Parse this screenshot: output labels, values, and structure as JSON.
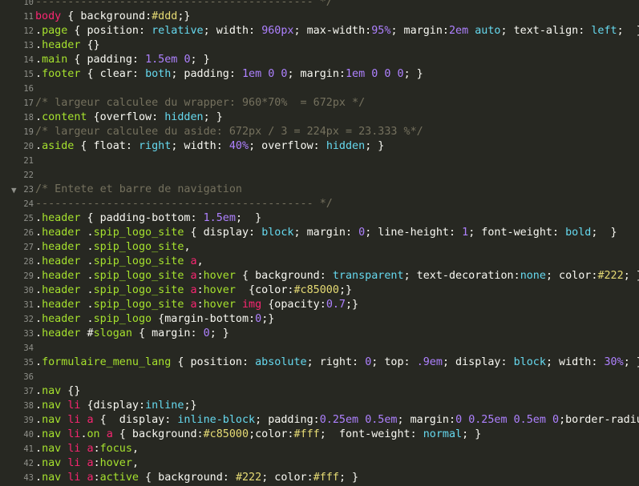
{
  "theme": {
    "background": "#272822",
    "foreground": "#f8f8f2",
    "comment": "#75715e",
    "keyword": "#f92672",
    "selector": "#a6e22e",
    "property": "#66d9ef",
    "number": "#ae81ff",
    "string": "#e6db74",
    "gutter": "#8f908a"
  },
  "editor": {
    "fold_icon": "triangle-down",
    "lines": [
      {
        "num": "10",
        "fold": false,
        "tokens": [
          [
            "comment",
            "------------------------------------------- */"
          ]
        ]
      },
      {
        "num": "11",
        "fold": false,
        "tokens": [
          [
            "tag",
            "body"
          ],
          [
            "plain",
            " { background"
          ],
          [
            "plain",
            ":"
          ],
          [
            "color",
            "#ddd"
          ],
          [
            "plain",
            ";}"
          ]
        ]
      },
      {
        "num": "12",
        "fold": false,
        "tokens": [
          [
            "plain",
            "."
          ],
          [
            "class",
            "page"
          ],
          [
            "plain",
            " { position: "
          ],
          [
            "prop",
            "relative"
          ],
          [
            "plain",
            "; width: "
          ],
          [
            "num",
            "960px"
          ],
          [
            "plain",
            "; max-width:"
          ],
          [
            "num",
            "95%"
          ],
          [
            "plain",
            "; margin:"
          ],
          [
            "num",
            "2em"
          ],
          [
            "plain",
            " "
          ],
          [
            "prop",
            "auto"
          ],
          [
            "plain",
            "; text-align: "
          ],
          [
            "prop",
            "left"
          ],
          [
            "plain",
            ";  }"
          ]
        ]
      },
      {
        "num": "13",
        "fold": false,
        "tokens": [
          [
            "plain",
            "."
          ],
          [
            "class",
            "header"
          ],
          [
            "plain",
            " {}"
          ]
        ]
      },
      {
        "num": "14",
        "fold": false,
        "tokens": [
          [
            "plain",
            "."
          ],
          [
            "class",
            "main"
          ],
          [
            "plain",
            " { padding: "
          ],
          [
            "num",
            "1.5em"
          ],
          [
            "plain",
            " "
          ],
          [
            "num",
            "0"
          ],
          [
            "plain",
            "; }"
          ]
        ]
      },
      {
        "num": "15",
        "fold": false,
        "tokens": [
          [
            "plain",
            "."
          ],
          [
            "class",
            "footer"
          ],
          [
            "plain",
            " { clear: "
          ],
          [
            "prop",
            "both"
          ],
          [
            "plain",
            "; padding: "
          ],
          [
            "num",
            "1em"
          ],
          [
            "plain",
            " "
          ],
          [
            "num",
            "0"
          ],
          [
            "plain",
            " "
          ],
          [
            "num",
            "0"
          ],
          [
            "plain",
            "; margin:"
          ],
          [
            "num",
            "1em"
          ],
          [
            "plain",
            " "
          ],
          [
            "num",
            "0"
          ],
          [
            "plain",
            " "
          ],
          [
            "num",
            "0"
          ],
          [
            "plain",
            " "
          ],
          [
            "num",
            "0"
          ],
          [
            "plain",
            "; }"
          ]
        ]
      },
      {
        "num": "16",
        "fold": false,
        "tokens": []
      },
      {
        "num": "17",
        "fold": false,
        "tokens": [
          [
            "comment",
            "/* largeur calculee du wrapper: 960*70%  = 672px */"
          ]
        ]
      },
      {
        "num": "18",
        "fold": false,
        "tokens": [
          [
            "plain",
            "."
          ],
          [
            "class",
            "content"
          ],
          [
            "plain",
            " {overflow: "
          ],
          [
            "prop",
            "hidden"
          ],
          [
            "plain",
            "; }"
          ]
        ]
      },
      {
        "num": "19",
        "fold": false,
        "tokens": [
          [
            "comment",
            "/* largeur calculee du aside: 672px / 3 = 224px = 23.333 %*/"
          ]
        ]
      },
      {
        "num": "20",
        "fold": false,
        "tokens": [
          [
            "plain",
            "."
          ],
          [
            "class",
            "aside"
          ],
          [
            "plain",
            " { float: "
          ],
          [
            "prop",
            "right"
          ],
          [
            "plain",
            "; width: "
          ],
          [
            "num",
            "40%"
          ],
          [
            "plain",
            "; overflow: "
          ],
          [
            "prop",
            "hidden"
          ],
          [
            "plain",
            "; }"
          ]
        ]
      },
      {
        "num": "21",
        "fold": false,
        "tokens": []
      },
      {
        "num": "22",
        "fold": false,
        "tokens": []
      },
      {
        "num": "23",
        "fold": true,
        "tokens": [
          [
            "comment",
            "/* Entete et barre de navigation"
          ]
        ]
      },
      {
        "num": "24",
        "fold": false,
        "tokens": [
          [
            "comment",
            "------------------------------------------- */"
          ]
        ]
      },
      {
        "num": "25",
        "fold": false,
        "tokens": [
          [
            "plain",
            "."
          ],
          [
            "class",
            "header"
          ],
          [
            "plain",
            " { padding-bottom: "
          ],
          [
            "num",
            "1.5em"
          ],
          [
            "plain",
            ";  }"
          ]
        ]
      },
      {
        "num": "26",
        "fold": false,
        "tokens": [
          [
            "plain",
            "."
          ],
          [
            "class",
            "header"
          ],
          [
            "plain",
            " ."
          ],
          [
            "class",
            "spip_logo_site"
          ],
          [
            "plain",
            " { display: "
          ],
          [
            "prop",
            "block"
          ],
          [
            "plain",
            "; margin: "
          ],
          [
            "num",
            "0"
          ],
          [
            "plain",
            "; line-height: "
          ],
          [
            "num",
            "1"
          ],
          [
            "plain",
            "; font-weight: "
          ],
          [
            "prop",
            "bold"
          ],
          [
            "plain",
            ";  }"
          ]
        ]
      },
      {
        "num": "27",
        "fold": false,
        "tokens": [
          [
            "plain",
            "."
          ],
          [
            "class",
            "header"
          ],
          [
            "plain",
            " ."
          ],
          [
            "class",
            "spip_logo_site"
          ],
          [
            "plain",
            ","
          ]
        ]
      },
      {
        "num": "28",
        "fold": false,
        "tokens": [
          [
            "plain",
            "."
          ],
          [
            "class",
            "header"
          ],
          [
            "plain",
            " ."
          ],
          [
            "class",
            "spip_logo_site"
          ],
          [
            "plain",
            " "
          ],
          [
            "tag",
            "a"
          ],
          [
            "plain",
            ","
          ]
        ]
      },
      {
        "num": "29",
        "fold": false,
        "tokens": [
          [
            "plain",
            "."
          ],
          [
            "class",
            "header"
          ],
          [
            "plain",
            " ."
          ],
          [
            "class",
            "spip_logo_site"
          ],
          [
            "plain",
            " "
          ],
          [
            "tag",
            "a"
          ],
          [
            "plain",
            ":"
          ],
          [
            "class",
            "hover"
          ],
          [
            "plain",
            " { background: "
          ],
          [
            "prop",
            "transparent"
          ],
          [
            "plain",
            "; text-decoration:"
          ],
          [
            "prop",
            "none"
          ],
          [
            "plain",
            "; color:"
          ],
          [
            "color",
            "#222"
          ],
          [
            "plain",
            "; }"
          ]
        ]
      },
      {
        "num": "30",
        "fold": false,
        "tokens": [
          [
            "plain",
            "."
          ],
          [
            "class",
            "header"
          ],
          [
            "plain",
            " ."
          ],
          [
            "class",
            "spip_logo_site"
          ],
          [
            "plain",
            " "
          ],
          [
            "tag",
            "a"
          ],
          [
            "plain",
            ":"
          ],
          [
            "class",
            "hover"
          ],
          [
            "plain",
            "  {color:"
          ],
          [
            "color",
            "#c85000"
          ],
          [
            "plain",
            ";}"
          ]
        ]
      },
      {
        "num": "31",
        "fold": false,
        "tokens": [
          [
            "plain",
            "."
          ],
          [
            "class",
            "header"
          ],
          [
            "plain",
            " ."
          ],
          [
            "class",
            "spip_logo_site"
          ],
          [
            "plain",
            " "
          ],
          [
            "tag",
            "a"
          ],
          [
            "plain",
            ":"
          ],
          [
            "class",
            "hover"
          ],
          [
            "plain",
            " "
          ],
          [
            "tag",
            "img"
          ],
          [
            "plain",
            " {opacity:"
          ],
          [
            "num",
            "0.7"
          ],
          [
            "plain",
            ";}"
          ]
        ]
      },
      {
        "num": "32",
        "fold": false,
        "tokens": [
          [
            "plain",
            "."
          ],
          [
            "class",
            "header"
          ],
          [
            "plain",
            " ."
          ],
          [
            "class",
            "spip_logo"
          ],
          [
            "plain",
            " {margin-bottom:"
          ],
          [
            "num",
            "0"
          ],
          [
            "plain",
            ";}"
          ]
        ]
      },
      {
        "num": "33",
        "fold": false,
        "tokens": [
          [
            "plain",
            "."
          ],
          [
            "class",
            "header"
          ],
          [
            "plain",
            " #"
          ],
          [
            "class",
            "slogan"
          ],
          [
            "plain",
            " { margin: "
          ],
          [
            "num",
            "0"
          ],
          [
            "plain",
            "; }"
          ]
        ]
      },
      {
        "num": "34",
        "fold": false,
        "tokens": []
      },
      {
        "num": "35",
        "fold": false,
        "tokens": [
          [
            "plain",
            "."
          ],
          [
            "class",
            "formulaire_menu_lang"
          ],
          [
            "plain",
            " { position: "
          ],
          [
            "prop",
            "absolute"
          ],
          [
            "plain",
            "; right: "
          ],
          [
            "num",
            "0"
          ],
          [
            "plain",
            "; top: "
          ],
          [
            "num",
            ".9em"
          ],
          [
            "plain",
            "; display: "
          ],
          [
            "prop",
            "block"
          ],
          [
            "plain",
            "; width: "
          ],
          [
            "num",
            "30%"
          ],
          [
            "plain",
            "; }"
          ]
        ]
      },
      {
        "num": "36",
        "fold": false,
        "tokens": []
      },
      {
        "num": "37",
        "fold": false,
        "tokens": [
          [
            "plain",
            "."
          ],
          [
            "class",
            "nav"
          ],
          [
            "plain",
            " {}"
          ]
        ]
      },
      {
        "num": "38",
        "fold": false,
        "tokens": [
          [
            "plain",
            "."
          ],
          [
            "class",
            "nav"
          ],
          [
            "plain",
            " "
          ],
          [
            "tag",
            "li"
          ],
          [
            "plain",
            " {display:"
          ],
          [
            "prop",
            "inline"
          ],
          [
            "plain",
            ";}"
          ]
        ]
      },
      {
        "num": "39",
        "fold": false,
        "tokens": [
          [
            "plain",
            "."
          ],
          [
            "class",
            "nav"
          ],
          [
            "plain",
            " "
          ],
          [
            "tag",
            "li"
          ],
          [
            "plain",
            " "
          ],
          [
            "tag",
            "a"
          ],
          [
            "plain",
            " {  display: "
          ],
          [
            "prop",
            "inline-block"
          ],
          [
            "plain",
            "; padding:"
          ],
          [
            "num",
            "0.25em"
          ],
          [
            "plain",
            " "
          ],
          [
            "num",
            "0.5em"
          ],
          [
            "plain",
            "; margin:"
          ],
          [
            "num",
            "0"
          ],
          [
            "plain",
            " "
          ],
          [
            "num",
            "0.25em"
          ],
          [
            "plain",
            " "
          ],
          [
            "num",
            "0.5em"
          ],
          [
            "plain",
            " "
          ],
          [
            "num",
            "0"
          ],
          [
            "plain",
            ";border-radius:"
          ]
        ]
      },
      {
        "num": "40",
        "fold": false,
        "tokens": [
          [
            "plain",
            "."
          ],
          [
            "class",
            "nav"
          ],
          [
            "plain",
            " "
          ],
          [
            "tag",
            "li"
          ],
          [
            "plain",
            "."
          ],
          [
            "class",
            "on"
          ],
          [
            "plain",
            " "
          ],
          [
            "tag",
            "a"
          ],
          [
            "plain",
            " { background:"
          ],
          [
            "color",
            "#c85000"
          ],
          [
            "plain",
            ";color:"
          ],
          [
            "color",
            "#fff"
          ],
          [
            "plain",
            ";  font-weight: "
          ],
          [
            "prop",
            "normal"
          ],
          [
            "plain",
            "; }"
          ]
        ]
      },
      {
        "num": "41",
        "fold": false,
        "tokens": [
          [
            "plain",
            "."
          ],
          [
            "class",
            "nav"
          ],
          [
            "plain",
            " "
          ],
          [
            "tag",
            "li"
          ],
          [
            "plain",
            " "
          ],
          [
            "tag",
            "a"
          ],
          [
            "plain",
            ":"
          ],
          [
            "class",
            "focus"
          ],
          [
            "plain",
            ","
          ]
        ]
      },
      {
        "num": "42",
        "fold": false,
        "tokens": [
          [
            "plain",
            "."
          ],
          [
            "class",
            "nav"
          ],
          [
            "plain",
            " "
          ],
          [
            "tag",
            "li"
          ],
          [
            "plain",
            " "
          ],
          [
            "tag",
            "a"
          ],
          [
            "plain",
            ":"
          ],
          [
            "class",
            "hover"
          ],
          [
            "plain",
            ","
          ]
        ]
      },
      {
        "num": "43",
        "fold": false,
        "tokens": [
          [
            "plain",
            "."
          ],
          [
            "class",
            "nav"
          ],
          [
            "plain",
            " "
          ],
          [
            "tag",
            "li"
          ],
          [
            "plain",
            " "
          ],
          [
            "tag",
            "a"
          ],
          [
            "plain",
            ":"
          ],
          [
            "class",
            "active"
          ],
          [
            "plain",
            " { background: "
          ],
          [
            "color",
            "#222"
          ],
          [
            "plain",
            "; color:"
          ],
          [
            "color",
            "#fff"
          ],
          [
            "plain",
            "; }"
          ]
        ]
      }
    ]
  }
}
